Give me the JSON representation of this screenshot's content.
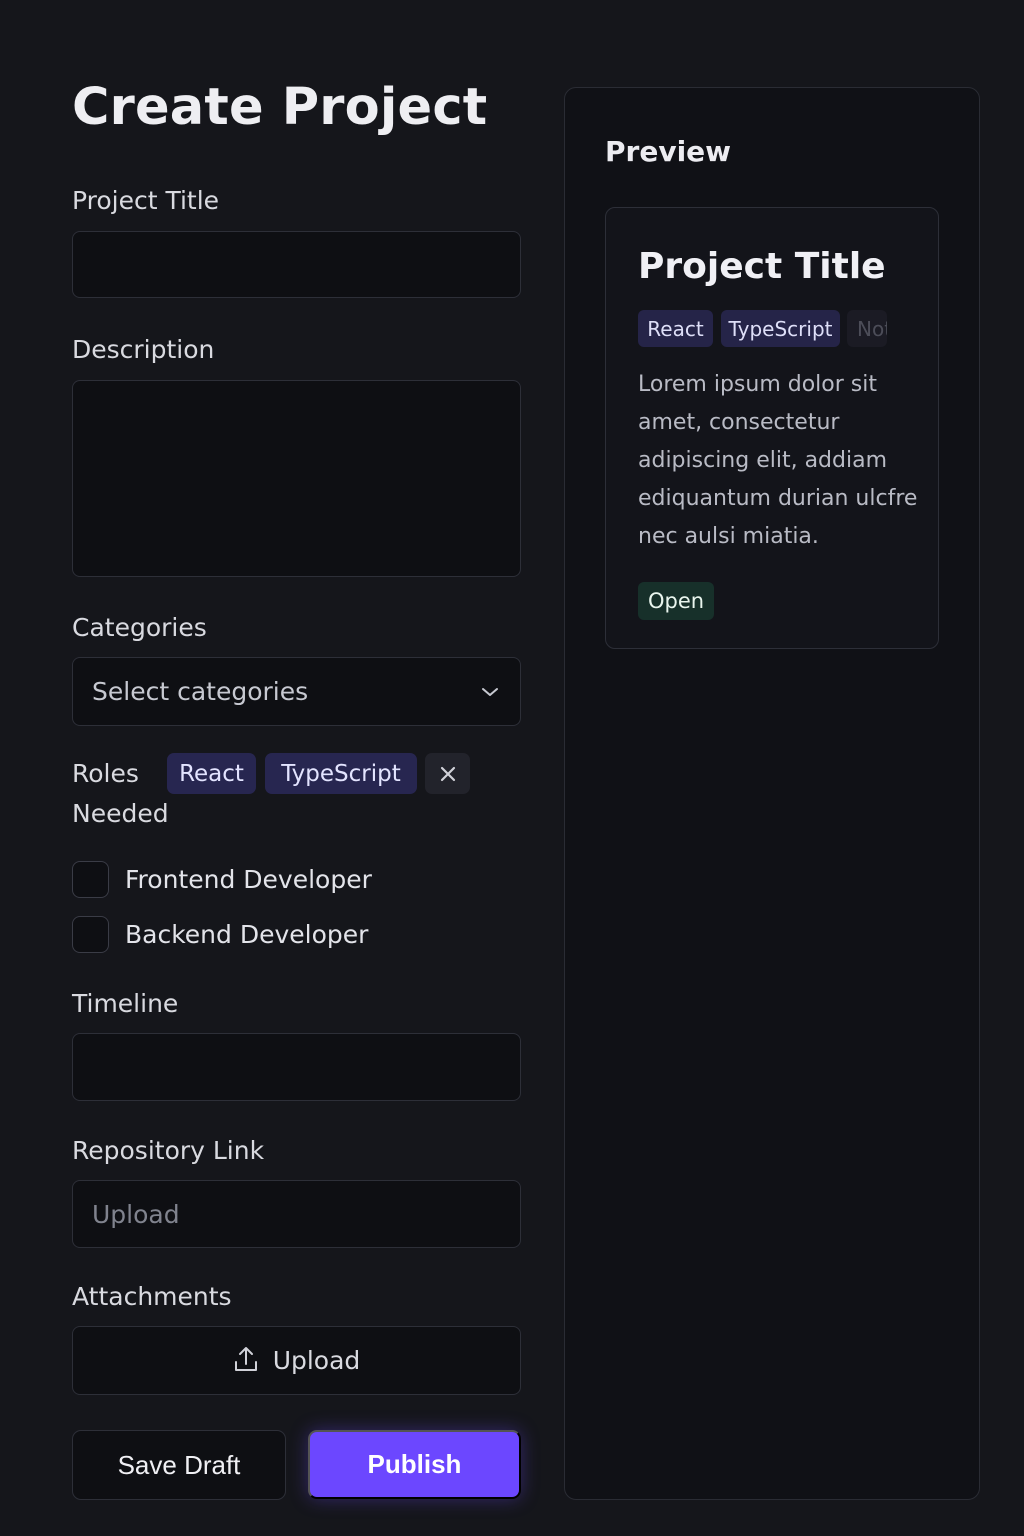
{
  "form": {
    "page_title": "Create Project",
    "project_title": {
      "label": "Project Title",
      "value": ""
    },
    "description": {
      "label": "Description",
      "value": ""
    },
    "categories": {
      "label": "Categories",
      "placeholder": "Select categories"
    },
    "roles": {
      "label": "Roles Needed",
      "tags": [
        "React",
        "TypeScript"
      ],
      "options": [
        {
          "label": "Frontend Developer",
          "checked": false
        },
        {
          "label": "Backend Developer",
          "checked": false
        }
      ]
    },
    "timeline": {
      "label": "Timeline",
      "value": ""
    },
    "repository": {
      "label": "Repository Link",
      "placeholder": "Upload"
    },
    "attachments": {
      "label": "Attachments",
      "button_label": "Upload"
    },
    "actions": {
      "save_draft": "Save Draft",
      "publish": "Publish"
    }
  },
  "preview": {
    "heading": "Preview",
    "card": {
      "title": "Project Title",
      "tags": [
        "React",
        "TypeScript",
        "Not"
      ],
      "description": "Lorem ipsum dolor sit amet, consectetur adipiscing elit, addiam ediquantum durian ulcfre nec aulsi miatia.",
      "status": "Open"
    }
  },
  "colors": {
    "background": "#15161b",
    "accent": "#6c47ff",
    "tag_background": "#272650",
    "status_background": "#17302a"
  },
  "icons": {
    "dropdown": "chevron-down-icon",
    "remove_tag": "close-icon",
    "upload": "upload-icon"
  }
}
